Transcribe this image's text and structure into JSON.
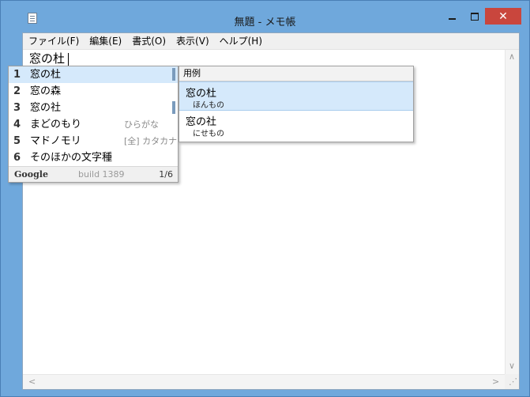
{
  "window": {
    "title": "無題 - メモ帳",
    "controls": {
      "minimize": "",
      "maximize": "",
      "close": "✕"
    }
  },
  "menu": {
    "items": [
      "ファイル(F)",
      "編集(E)",
      "書式(O)",
      "表示(V)",
      "ヘルプ(H)"
    ]
  },
  "editor": {
    "composition_text": "窓の杜"
  },
  "candidates": {
    "items": [
      {
        "num": "1",
        "text": "窓の杜",
        "hint": ""
      },
      {
        "num": "2",
        "text": "窓の森",
        "hint": ""
      },
      {
        "num": "3",
        "text": "窓の社",
        "hint": ""
      },
      {
        "num": "4",
        "text": "まどのもり",
        "hint": "ひらがな"
      },
      {
        "num": "5",
        "text": "マドノモリ",
        "hint": "[全] カタカナ"
      },
      {
        "num": "6",
        "text": "そのほかの文字種",
        "hint": ""
      }
    ],
    "footer": {
      "brand": "Google",
      "build": "build 1389",
      "page": "1/6"
    }
  },
  "usage": {
    "header": "用例",
    "items": [
      {
        "word": "窓の杜",
        "reading": "ほんもの"
      },
      {
        "word": "窓の社",
        "reading": "にせもの"
      }
    ]
  },
  "scrollbars": {
    "up": "∧",
    "down": "∨",
    "left": "<",
    "right": ">",
    "grip": "⋰"
  },
  "colors": {
    "frame": "#6fa8dc",
    "close": "#c9463d",
    "selection": "#d5e9fb"
  }
}
